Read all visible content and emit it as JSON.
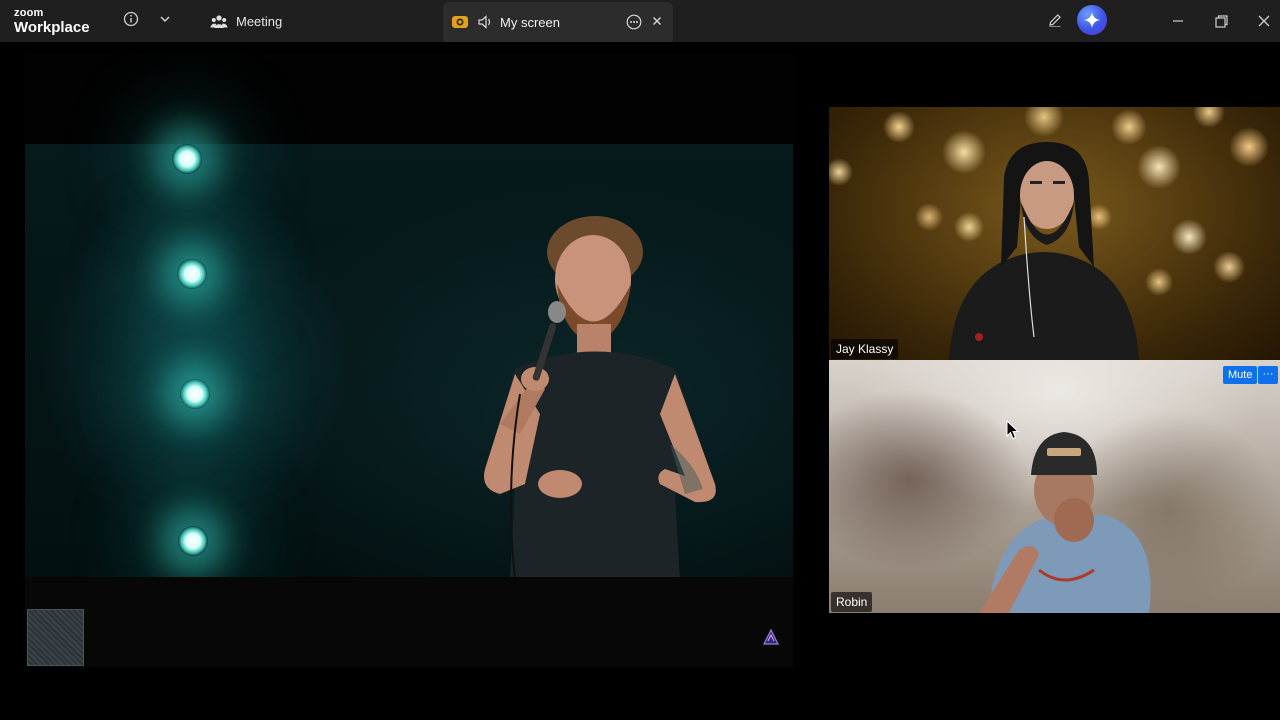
{
  "app": {
    "logo_top": "zoom",
    "logo_bottom": "Workplace"
  },
  "titlebar": {
    "meeting_tab_label": "Meeting",
    "active_tab_label": "My screen"
  },
  "participants": [
    {
      "name": "Jay Klassy"
    },
    {
      "name": "Robin",
      "actions": {
        "mute_label": "Mute",
        "more_label": "···"
      }
    }
  ],
  "colors": {
    "accent": "#0e71eb",
    "titlebar": "#1f1f1f",
    "active_tab": "#2c2c2c"
  }
}
